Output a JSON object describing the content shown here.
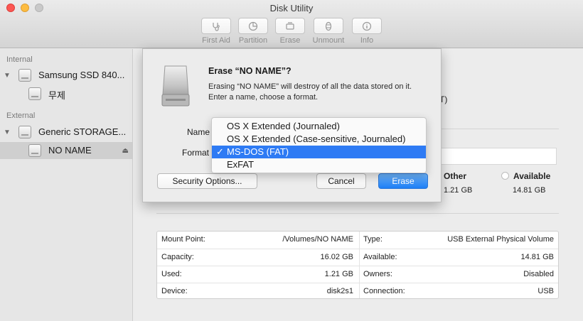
{
  "window": {
    "title": "Disk Utility"
  },
  "toolbar": {
    "buttons": [
      {
        "label": "First Aid",
        "icon": "stethoscope-icon"
      },
      {
        "label": "Partition",
        "icon": "pie-chart-icon"
      },
      {
        "label": "Erase",
        "icon": "erase-icon"
      },
      {
        "label": "Unmount",
        "icon": "unmount-icon"
      },
      {
        "label": "Info",
        "icon": "info-icon"
      }
    ]
  },
  "sidebar": {
    "internal_heading": "Internal",
    "external_heading": "External",
    "items": [
      {
        "label": "Samsung SSD 840..."
      },
      {
        "label": "무제"
      },
      {
        "label": "Generic STORAGE..."
      },
      {
        "label": "NO NAME"
      }
    ]
  },
  "background": {
    "type_fragment": "T)",
    "legend": [
      {
        "label": "Other",
        "value": "1.21 GB"
      },
      {
        "label": "Available",
        "value": "14.81 GB"
      }
    ]
  },
  "info": {
    "left": [
      {
        "label": "Mount Point:",
        "value": "/Volumes/NO NAME"
      },
      {
        "label": "Capacity:",
        "value": "16.02 GB"
      },
      {
        "label": "Used:",
        "value": "1.21 GB"
      },
      {
        "label": "Device:",
        "value": "disk2s1"
      }
    ],
    "right": [
      {
        "label": "Type:",
        "value": "USB External Physical Volume"
      },
      {
        "label": "Available:",
        "value": "14.81 GB"
      },
      {
        "label": "Owners:",
        "value": "Disabled"
      },
      {
        "label": "Connection:",
        "value": "USB"
      }
    ]
  },
  "dialog": {
    "title": "Erase “NO NAME”?",
    "message": "Erasing “NO NAME” will destroy of all the data stored on it. Enter a name, choose a format.",
    "name_label": "Name",
    "format_label": "Format",
    "security_button": "Security Options...",
    "cancel_button": "Cancel",
    "erase_button": "Erase"
  },
  "format_menu": {
    "check": "✓",
    "selected_index": 2,
    "options": [
      "OS X Extended (Journaled)",
      "OS X Extended (Case-sensitive, Journaled)",
      "MS-DOS (FAT)",
      "ExFAT"
    ]
  }
}
